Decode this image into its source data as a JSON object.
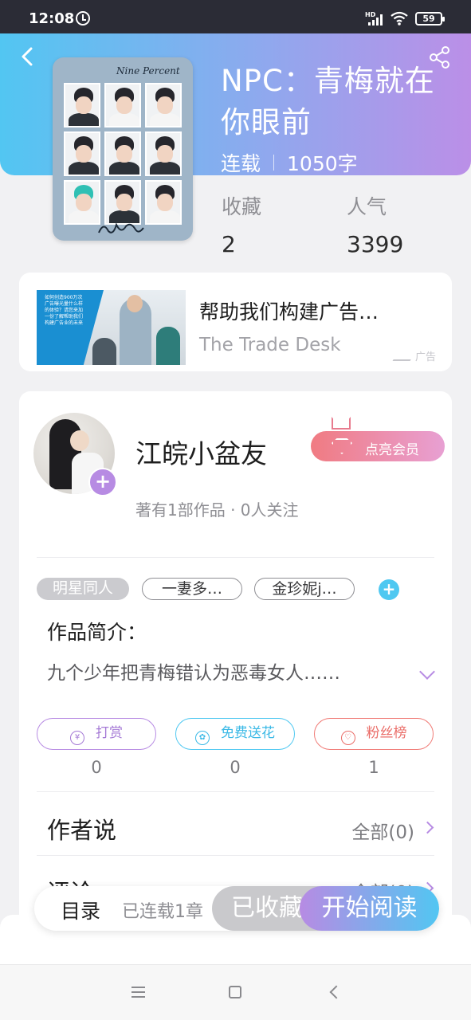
{
  "status_bar": {
    "time": "12:08",
    "network": "HD",
    "battery": "59"
  },
  "book": {
    "title": "NPC：青梅就在你眼前",
    "status": "连载",
    "word_count": "1050字",
    "cover_title": "Nine Percent",
    "stats": [
      {
        "label": "收藏",
        "value": "2"
      },
      {
        "label": "人气",
        "value": "3399"
      }
    ]
  },
  "ad": {
    "title": "帮助我们构建广告…",
    "source": "The Trade Desk",
    "badge": "广告",
    "image_text": "如何创造900万次广告曝光量什么样的体验？请您来加一份了解帮助我们构建广告业的未来"
  },
  "author": {
    "name": "江皖小盆友",
    "stats": "著有1部作品 · 0人关注",
    "vip_label": "点亮会员"
  },
  "tags": [
    "明星同人",
    "一妻多…",
    "金珍妮j…"
  ],
  "intro": {
    "label": "作品简介：",
    "text": "九个少年把青梅错认为恶毒女人……"
  },
  "actions": [
    {
      "label": "打赏",
      "count": "0",
      "icon": "yen-icon"
    },
    {
      "label": "免费送花",
      "count": "0",
      "icon": "flower-icon"
    },
    {
      "label": "粉丝榜",
      "count": "1",
      "icon": "user-heart-icon"
    }
  ],
  "sections": [
    {
      "label": "作者说",
      "value": "全部(0)"
    },
    {
      "label": "评论",
      "value": "全部(0)"
    }
  ],
  "bottom_bar": {
    "toc_label": "目录",
    "toc_count": "已连载1章",
    "collected_label": "已收藏",
    "read_label": "开始阅读"
  },
  "colors": {
    "header_start": "#52c6f2",
    "header_end": "#bb8fe7",
    "accent_purple": "#b78be3",
    "accent_blue": "#4fc8f1",
    "accent_red": "#f07b76"
  }
}
